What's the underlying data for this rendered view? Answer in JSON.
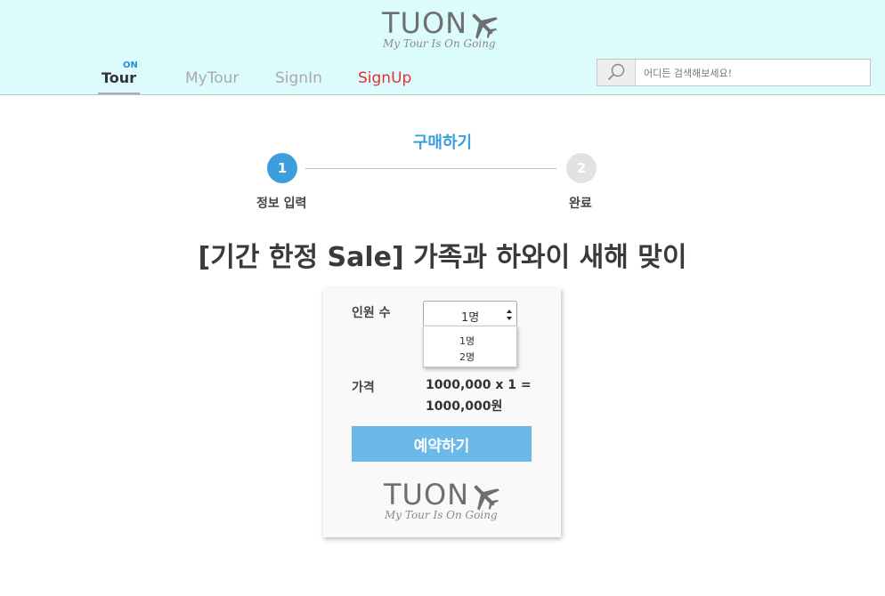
{
  "header": {
    "brand": "TUON",
    "tagline": "My Tour Is On Going",
    "nav": {
      "home_badge": "ON",
      "home": "Tour",
      "mytour": "MyTour",
      "signin": "SignIn",
      "signup": "SignUp"
    },
    "search": {
      "placeholder": "어디든 검색해보세요!"
    }
  },
  "steps": {
    "title": "구매하기",
    "items": [
      {
        "number": "1",
        "label": "정보 입력"
      },
      {
        "number": "2",
        "label": "완료"
      }
    ]
  },
  "product": {
    "title": "[기간 한정 Sale] 가족과 하와이 새해 맞이"
  },
  "form": {
    "people_label": "인원 수",
    "people_selected": "1명",
    "people_options": [
      "1명",
      "2명"
    ],
    "price_label": "가격",
    "price_formula": "1000,000 x 1 =",
    "price_total": "1000,000원",
    "reserve_button": "예약하기"
  },
  "colors": {
    "header_bg": "#dcfbfd",
    "accent": "#3a9fdc",
    "button": "#6bb9e8",
    "signup": "#e53030"
  },
  "icons": {
    "search": "search-icon",
    "plane": "plane-icon"
  }
}
